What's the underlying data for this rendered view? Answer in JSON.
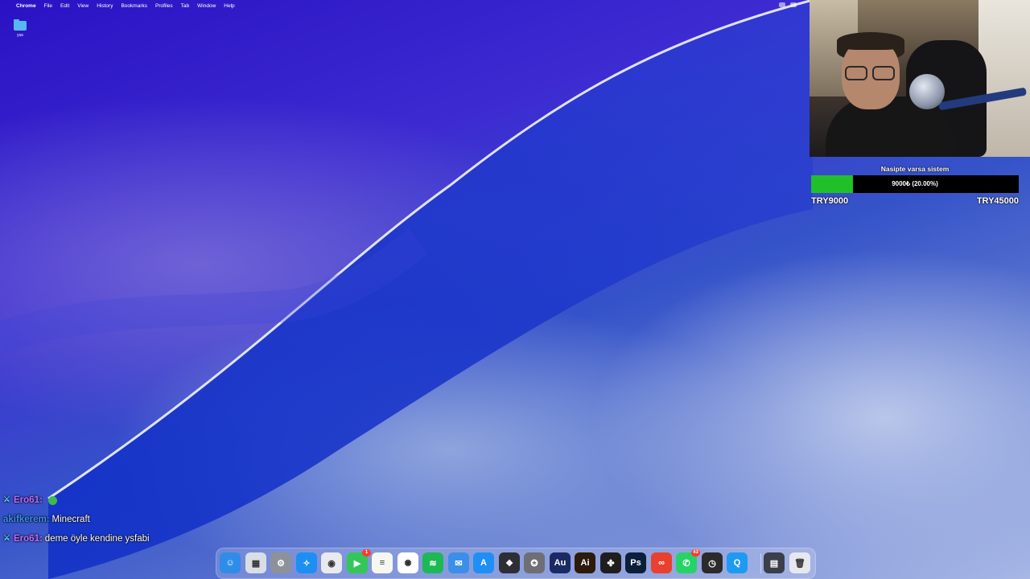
{
  "menubar": {
    "apple": "",
    "app_name": "Chrome",
    "items": [
      "File",
      "Edit",
      "View",
      "History",
      "Bookmarks",
      "Profiles",
      "Tab",
      "Window",
      "Help"
    ]
  },
  "desktop": {
    "folder_label": "yus"
  },
  "goal": {
    "title": "Nasipte varsa sistem",
    "progress_text": "9000₺ (20.00%)",
    "progress_fraction": 0.2,
    "min_label": "TRY9000",
    "max_label": "TRY45000",
    "fill_color": "#1fc02a"
  },
  "chat": [
    {
      "user": "Ero61:",
      "message": "",
      "user_color": "#c06bff",
      "has_emote": true
    },
    {
      "user": "akifkerem:",
      "message": "Minecraft",
      "user_color": "#3a8ff0",
      "has_emote": false
    },
    {
      "user": "Ero61:",
      "message": "deme öyle kendine ysfabi",
      "user_color": "#c06bff",
      "has_emote": false
    }
  ],
  "dock": {
    "icons": [
      {
        "name": "finder-icon",
        "glyph": "☺",
        "color": "#2f8de8"
      },
      {
        "name": "launchpad-icon",
        "glyph": "▦",
        "color": "#d9dde6"
      },
      {
        "name": "system-settings-icon",
        "glyph": "⚙",
        "color": "#8d9199"
      },
      {
        "name": "safari-icon",
        "glyph": "✧",
        "color": "#1d8ff2"
      },
      {
        "name": "chrome-icon",
        "glyph": "◉",
        "color": "#e8eaed"
      },
      {
        "name": "facetime-icon",
        "glyph": "▶",
        "color": "#33c759",
        "badge": "1"
      },
      {
        "name": "notes-icon",
        "glyph": "≡",
        "color": "#f7f7f2"
      },
      {
        "name": "chatgpt-icon",
        "glyph": "✺",
        "color": "#ffffff"
      },
      {
        "name": "spotify-icon",
        "glyph": "≋",
        "color": "#1db954"
      },
      {
        "name": "mail-icon",
        "glyph": "✉",
        "color": "#3c8fe8"
      },
      {
        "name": "app-store-icon",
        "glyph": "A",
        "color": "#1f8ff5"
      },
      {
        "name": "obs-icon",
        "glyph": "❖",
        "color": "#2e2e35"
      },
      {
        "name": "capture-icon",
        "glyph": "✪",
        "color": "#6e6f74"
      },
      {
        "name": "audition-icon",
        "glyph": "Au",
        "color": "#1c2a63"
      },
      {
        "name": "illustrator-icon",
        "glyph": "Ai",
        "color": "#2c1a0b"
      },
      {
        "name": "figma-icon",
        "glyph": "✤",
        "color": "#1e1e1e"
      },
      {
        "name": "photoshop-icon",
        "glyph": "Ps",
        "color": "#0b1f3a"
      },
      {
        "name": "creative-cloud-icon",
        "glyph": "∞",
        "color": "#e8412f"
      },
      {
        "name": "whatsapp-icon",
        "glyph": "✆",
        "color": "#25d366",
        "badge": "43"
      },
      {
        "name": "activity-monitor-icon",
        "glyph": "◷",
        "color": "#2b2b2b"
      },
      {
        "name": "quicktime-icon",
        "glyph": "Q",
        "color": "#1e9bf0"
      },
      {
        "name": "downloads-stack-icon",
        "glyph": "▤",
        "color": "#3a3f4a"
      },
      {
        "name": "trash-icon",
        "glyph": "🗑",
        "color": "#e6e8ee"
      }
    ]
  }
}
